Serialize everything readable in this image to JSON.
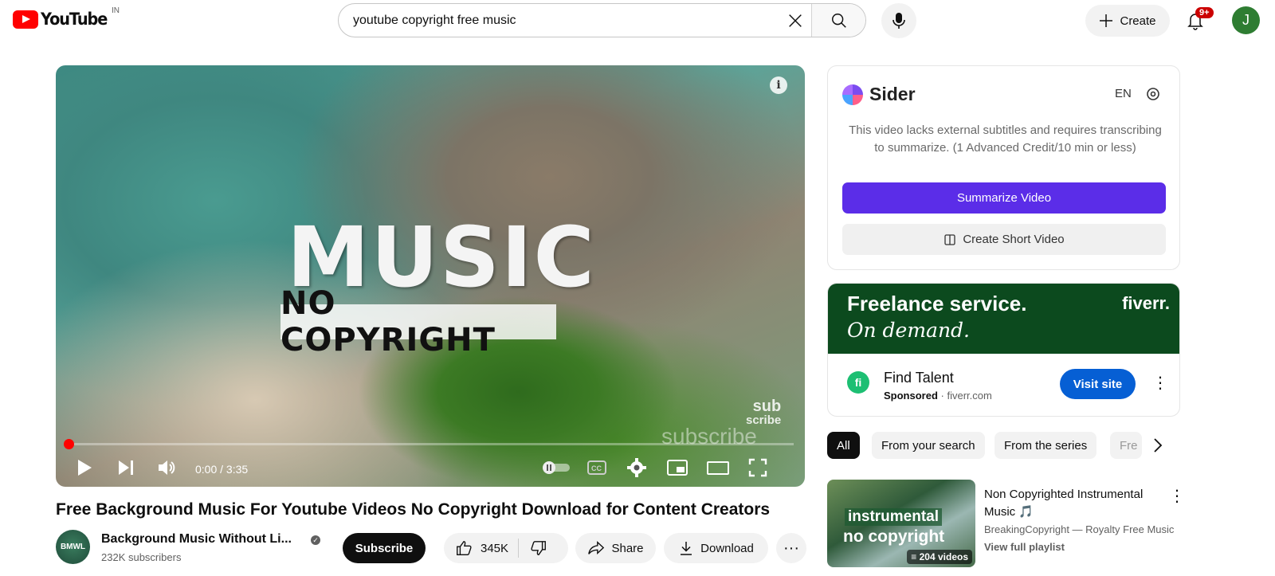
{
  "header": {
    "logo_text": "YouTube",
    "country_code": "IN",
    "search_value": "youtube copyright free music",
    "create_label": "Create",
    "notifications_badge": "9+",
    "avatar_initial": "J"
  },
  "player": {
    "overlay_title": "MUSIC",
    "overlay_subtitle": "NO COPYRIGHT",
    "watermark_top": "sub",
    "watermark_bottom": "scribe",
    "faded_text": "subscribe",
    "time_display": "0:00 / 3:35",
    "progress": 0.0
  },
  "video": {
    "title": "Free Background Music For Youtube Videos No Copyright Download for Content Creators",
    "channel_name": "Background Music Without Li...",
    "channel_avatar_text": "BMWL",
    "subscribers": "232K subscribers",
    "subscribe_label": "Subscribe",
    "likes": "345K",
    "share_label": "Share",
    "download_label": "Download"
  },
  "sider": {
    "brand": "Sider",
    "lang": "EN",
    "message": "This video lacks external subtitles and requires transcribing to summarize. (1 Advanced Credit/10 min or less)",
    "summarize_label": "Summarize Video",
    "short_label": "Create Short Video",
    "accent": "#5b2de8"
  },
  "ad": {
    "banner_line1": "Freelance service.",
    "banner_line2": "On demand.",
    "brand": "fiverr.",
    "icon_text": "fi",
    "title": "Find Talent",
    "sponsored": "Sponsored",
    "domain": "· fiverr.com",
    "cta": "Visit site",
    "banner_color": "#0c4a1e"
  },
  "chips": [
    {
      "label": "All",
      "active": true
    },
    {
      "label": "From your search",
      "active": false
    },
    {
      "label": "From the series",
      "active": false
    },
    {
      "label": "Fre",
      "active": false
    }
  ],
  "playlist": {
    "thumb_line1": "instrumental",
    "thumb_line2": "no copyright",
    "video_count": "204 videos",
    "title": "Non Copyrighted Instrumental Music 🎵",
    "channel": "BreakingCopyright — Royalty Free Music",
    "view_label": "View full playlist"
  }
}
